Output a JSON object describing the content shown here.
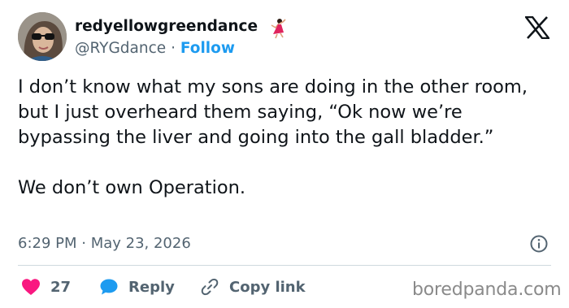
{
  "author": {
    "display_name": "redyellowgreendance",
    "handle": "@RYGdance",
    "separator": "·",
    "follow_label": "Follow"
  },
  "tweet": {
    "text": "I don’t know what my sons are doing in the other room, but I just overheard them saying, “Ok now we’re bypassing the liver and going into the gall bladder.”\n\nWe don’t own Operation.",
    "timestamp": "6:29 PM · May 23, 2026"
  },
  "actions": {
    "like_count": "27",
    "reply_label": "Reply",
    "copy_link_label": "Copy link"
  },
  "watermark": "boredpanda.com",
  "icons": [
    "avatar",
    "dancer-emoji-icon",
    "x-logo-icon",
    "info-icon",
    "heart-icon",
    "reply-bubble-icon",
    "link-icon"
  ],
  "colors": {
    "text": "#0f1419",
    "secondary": "#536471",
    "link": "#1d9bf0",
    "like": "#f91880",
    "divider": "#cfd9de"
  }
}
